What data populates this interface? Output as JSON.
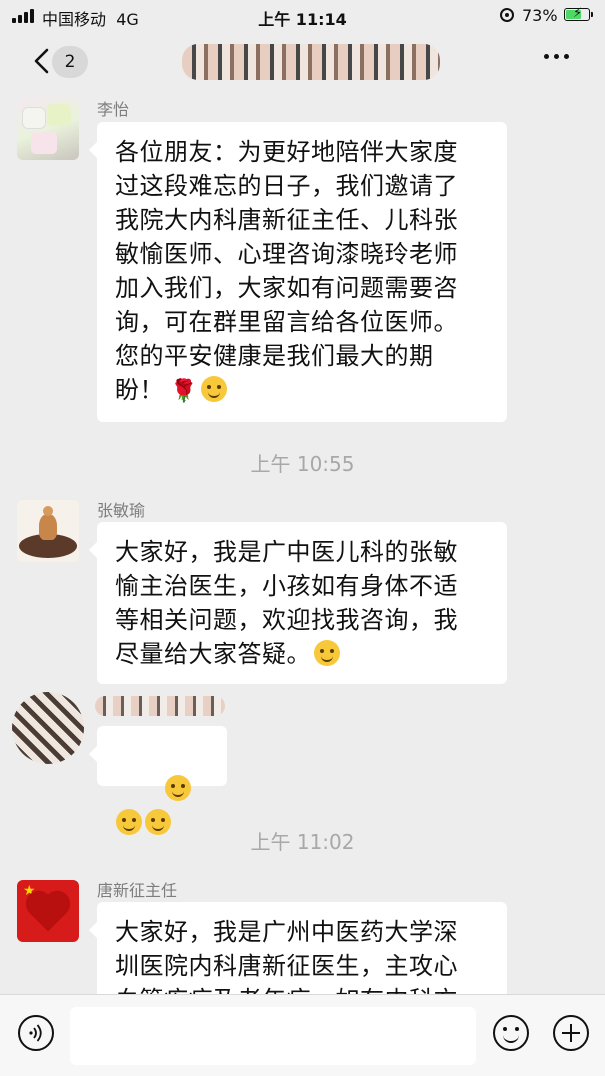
{
  "status_bar": {
    "carrier": "中国移动",
    "network": "4G",
    "time": "上午 11:14",
    "battery_percent": "73%",
    "battery_level": 0.73
  },
  "nav": {
    "unread_count": "2",
    "icons": [
      "chevron-left-icon",
      "more-icon"
    ]
  },
  "messages": [
    {
      "sender": "李怡",
      "text": "各位朋友：为更好地陪伴大家度\n过这段难忘的日子，我们邀请了\n我院大内科唐新征主任、儿科张\n敏愉医师、心理咨询漆晓玲老师\n加入我们，大家如有问题需要咨\n询，可在群里留言给各位医师。\n您的平安健康是我们最大的期\n盼！",
      "trailing_icons": [
        "rose-icon",
        "smile-icon"
      ]
    },
    {
      "time": "上午 10:55"
    },
    {
      "sender": "张敏瑜",
      "text": "大家好，我是广中医儿科的张敏\n愉主治医生，小孩如有身体不适\n等相关问题，欢迎找我咨询，我\n尽量给大家答疑。",
      "trailing_icons": [
        "smile-icon"
      ]
    },
    {
      "sender": "",
      "text": "",
      "trailing_icons": [
        "blush-icon",
        "blush-icon",
        "blush-icon"
      ]
    },
    {
      "time": "上午 11:02"
    },
    {
      "sender": "唐新征主任",
      "text": "大家好，我是广州中医药大学深\n圳医院内科唐新征医生，主攻心\n血管疾病及老年病，如有内科方"
    }
  ],
  "input_bar": {
    "icons": [
      "voice-icon",
      "emoji-icon",
      "plus-icon"
    ]
  }
}
